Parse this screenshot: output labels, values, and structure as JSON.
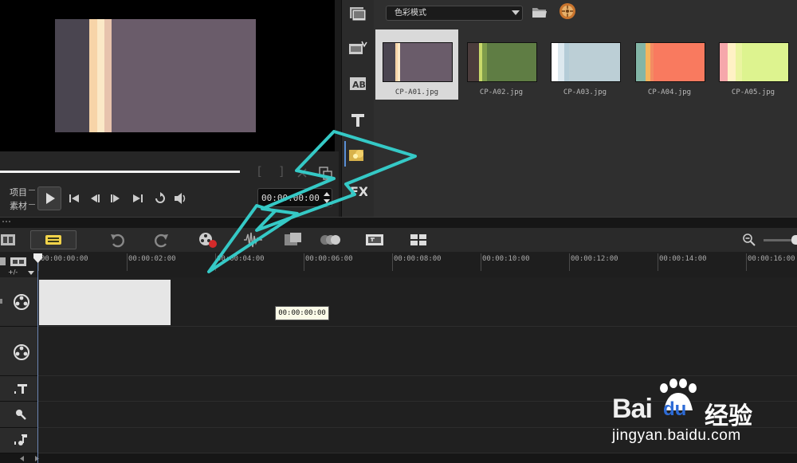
{
  "preview": {
    "frame_colors": [
      "#4a4550",
      "#f7d4a8",
      "#fbe9c7",
      "#e7c3ad",
      "#6a5c6a"
    ],
    "mode_project": "项目",
    "mode_clip": "素材",
    "timecode": "00:00:00:00",
    "mark_in": "[",
    "mark_out": "]",
    "progress": 0.71
  },
  "library": {
    "mode_label": "色彩模式",
    "items": [
      {
        "name": "CP-A01.jpg",
        "colors": [
          "#4a4550",
          "#f7d4a8",
          "#fbe9c7",
          "#6a5c6a"
        ],
        "selected": true
      },
      {
        "name": "CP-A02.jpg",
        "colors": [
          "#4b3c3c",
          "#c9d96a",
          "#7e9c4b",
          "#5f7d44"
        ],
        "selected": false
      },
      {
        "name": "CP-A03.jpg",
        "colors": [
          "#ffffff",
          "#dce8ee",
          "#b4ccd7",
          "#bccfd6"
        ],
        "selected": false
      },
      {
        "name": "CP-A04.jpg",
        "colors": [
          "#83b5a6",
          "#f5b55c",
          "#f38b63",
          "#f97a5f"
        ],
        "selected": false
      },
      {
        "name": "CP-A05.jpg",
        "colors": [
          "#f6a7ab",
          "#fff1c5",
          "#eaf4a0",
          "#ddf38f"
        ],
        "selected": false
      }
    ]
  },
  "timeline": {
    "ruler_labels": [
      "00:00:00:00",
      "00:00:02:00",
      "00:00:04:00",
      "00:00:06:00",
      "00:00:08:00",
      "00:00:10:00",
      "00:00:12:00",
      "00:00:14:00",
      "00:00:16:00"
    ],
    "tooltip": "00:00:00:00",
    "add_track_label": "+/-"
  },
  "watermark": {
    "brand": "Bai",
    "brand2": "du",
    "cn": "经验",
    "url": "jingyan.baidu.com"
  },
  "colors": {
    "annotation_stroke": "#35c9c6",
    "clip_fill": "#e6e6e6",
    "playhead": "#6c86b4"
  }
}
